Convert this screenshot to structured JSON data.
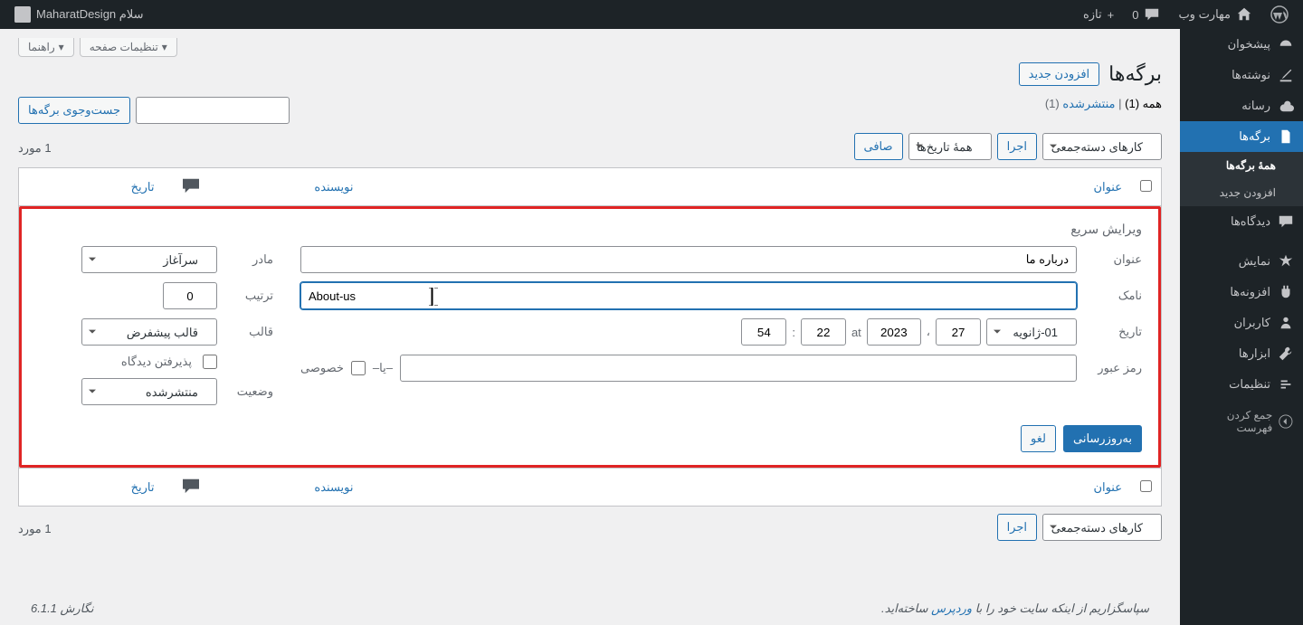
{
  "adminbar": {
    "site_name": "مهارت وب",
    "comments_count": "0",
    "new_label": "تازه",
    "howdy": "سلام MaharatDesign"
  },
  "sidebar": {
    "dashboard": "پیشخوان",
    "posts": "نوشته‌ها",
    "media": "رسانه",
    "pages": "برگه‌ها",
    "all_pages": "همهٔ برگه‌ها",
    "add_new_sub": "افزودن جدید",
    "comments": "دیدگاه‌ها",
    "appearance": "نمایش",
    "plugins": "افزونه‌ها",
    "users": "کاربران",
    "tools": "ابزارها",
    "settings": "تنظیمات",
    "collapse": "جمع کردن فهرست"
  },
  "screen": {
    "help": "راهنما",
    "options": "تنظیمات صفحه"
  },
  "heading": {
    "title": "برگه‌ها",
    "add_new": "افزودن جدید"
  },
  "subsub": {
    "all": "همه",
    "all_count": "(1)",
    "sep": " | ",
    "published": "منتشرشده",
    "published_count": "(1)"
  },
  "filters": {
    "bulk": "کارهای دسته‌جمعی",
    "apply": "اجرا",
    "all_dates": "همهٔ تاریخ‌ها",
    "filter": "صافی",
    "search": "جست‌وجوی برگه‌ها"
  },
  "count": "1 مورد",
  "table": {
    "title": "عنوان",
    "author": "نویسنده",
    "date": "تاریخ"
  },
  "quick_edit": {
    "heading": "ویرایش سریع",
    "title_label": "عنوان",
    "title_value": "درباره ما",
    "slug_label": "نامک",
    "slug_value": "About-us",
    "date_label": "تاریخ",
    "month_value": "01-ژانویه",
    "day_value": "27",
    "year_value": "2023",
    "hour_value": "22",
    "minute_value": "54",
    "at": "at",
    "comma": "،",
    "colon": ":",
    "password_label": "رمز عبور",
    "or": "–یا–",
    "private": "خصوصی",
    "parent_label": "مادر",
    "parent_value": "سرآغاز",
    "order_label": "ترتیب",
    "order_value": "0",
    "template_label": "قالب",
    "template_value": "قالب پیشفرض",
    "allow_comments": "پذیرفتن دیدگاه",
    "status_label": "وضعیت",
    "status_value": "منتشرشده",
    "update": "به‌روزرسانی",
    "cancel": "لغو"
  },
  "footer": {
    "thanks_pre": "سپاسگزاریم از اینکه سایت خود را با ",
    "wp": "وردپرس",
    "thanks_post": " ساخته‌اید.",
    "version": "نگارش 6.1.1"
  }
}
